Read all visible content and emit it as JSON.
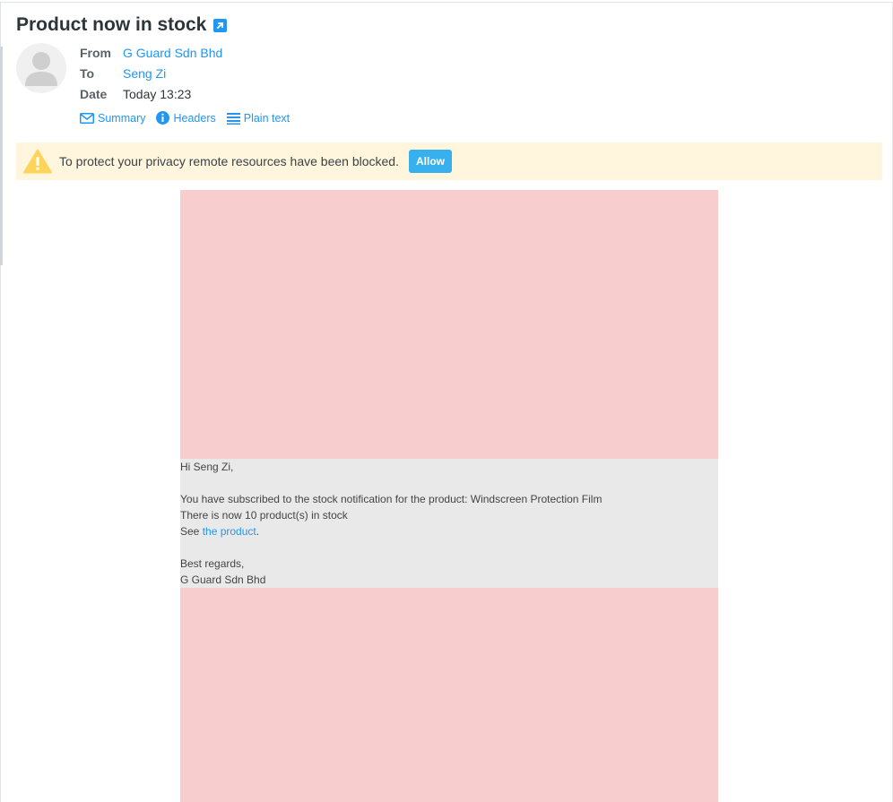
{
  "message": {
    "subject": "Product now in stock",
    "from_label": "From",
    "from_value": "G Guard Sdn Bhd",
    "to_label": "To",
    "to_value": "Seng Zi",
    "date_label": "Date",
    "date_value": "Today 13:23"
  },
  "view_links": {
    "summary": "Summary",
    "headers": "Headers",
    "plain_text": "Plain text"
  },
  "remote_warning": {
    "message": "To protect your privacy remote resources have been blocked.",
    "allow_label": "Allow"
  },
  "body": {
    "greeting": "Hi Seng Zi,",
    "line1": "You have subscribed to the stock notification for the product: Windscreen Protection Film",
    "line2": "There is now 10 product(s) in stock",
    "see_prefix": "See ",
    "product_link": "the product",
    "see_suffix": ".",
    "regards": "Best regards,",
    "signature": "G Guard Sdn Bhd"
  },
  "icons": {
    "open_external": "external-link-icon",
    "avatar": "user-avatar-icon",
    "summary": "envelope-icon",
    "headers": "info-icon",
    "plain_text": "lines-icon",
    "warning": "warning-triangle-icon"
  },
  "colors": {
    "accent": "#2196f3",
    "warning_bg": "#fff6dd",
    "blocked_image": "#f8cdcd",
    "body_bg": "#e9e9e9",
    "allow_button": "#37b0f0"
  }
}
